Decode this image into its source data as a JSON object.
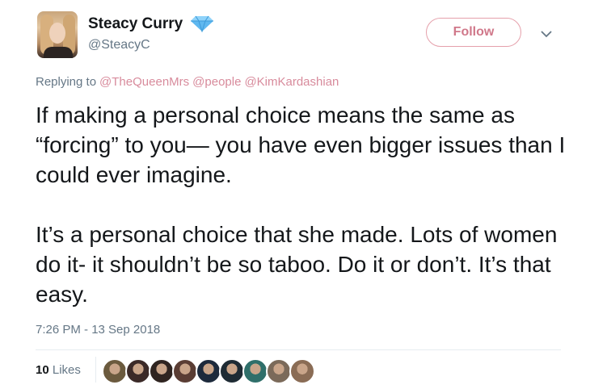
{
  "author": {
    "display_name": "Steacy Curry",
    "handle": "@SteacyC",
    "verified_color": "#5fb8f0"
  },
  "follow_button": {
    "label": "Follow",
    "color": "#d0788a"
  },
  "reply_context": {
    "prefix": "Replying to",
    "mentions": [
      "@TheQueenMrs",
      "@people",
      "@KimKardashian"
    ]
  },
  "tweet": {
    "paragraphs": [
      "If making a personal choice means the same as “forcing” to you— you have even bigger issues than I could ever imagine.",
      "It’s a personal choice that she made. Lots of women do it- it shouldn’t be so taboo. Do it or don’t. It’s that easy."
    ]
  },
  "timestamp": "7:26 PM - 13 Sep 2018",
  "engagement": {
    "likes_count": "10",
    "likes_label": "Likes",
    "liker_avatar_colors": [
      "#6b5a3e",
      "#3b2a28",
      "#2f2420",
      "#5a3d34",
      "#1d2a3c",
      "#1e2b34",
      "#2f6f6a",
      "#7b6a5a",
      "#8a6c55"
    ]
  }
}
